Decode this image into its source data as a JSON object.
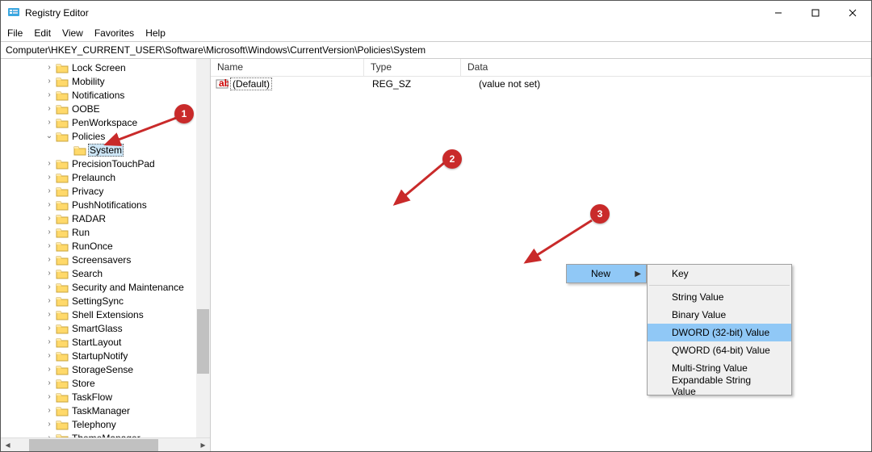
{
  "window": {
    "title": "Registry Editor"
  },
  "menu": {
    "file": "File",
    "edit": "Edit",
    "view": "View",
    "favorites": "Favorites",
    "help": "Help"
  },
  "address": {
    "value": "Computer\\HKEY_CURRENT_USER\\Software\\Microsoft\\Windows\\CurrentVersion\\Policies\\System"
  },
  "tree": {
    "nodes": [
      {
        "label": "Lock Screen",
        "expandable": true,
        "depth": 0
      },
      {
        "label": "Mobility",
        "expandable": true,
        "depth": 0
      },
      {
        "label": "Notifications",
        "expandable": true,
        "depth": 0
      },
      {
        "label": "OOBE",
        "expandable": true,
        "depth": 0
      },
      {
        "label": "PenWorkspace",
        "expandable": true,
        "depth": 0
      },
      {
        "label": "Policies",
        "expandable": true,
        "expanded": true,
        "depth": 0
      },
      {
        "label": "System",
        "expandable": false,
        "depth": 1,
        "selected": true
      },
      {
        "label": "PrecisionTouchPad",
        "expandable": true,
        "depth": 0
      },
      {
        "label": "Prelaunch",
        "expandable": true,
        "depth": 0
      },
      {
        "label": "Privacy",
        "expandable": true,
        "depth": 0
      },
      {
        "label": "PushNotifications",
        "expandable": true,
        "depth": 0
      },
      {
        "label": "RADAR",
        "expandable": true,
        "depth": 0
      },
      {
        "label": "Run",
        "expandable": true,
        "depth": 0
      },
      {
        "label": "RunOnce",
        "expandable": true,
        "depth": 0
      },
      {
        "label": "Screensavers",
        "expandable": true,
        "depth": 0
      },
      {
        "label": "Search",
        "expandable": true,
        "depth": 0
      },
      {
        "label": "Security and Maintenance",
        "expandable": true,
        "depth": 0
      },
      {
        "label": "SettingSync",
        "expandable": true,
        "depth": 0
      },
      {
        "label": "Shell Extensions",
        "expandable": true,
        "depth": 0
      },
      {
        "label": "SmartGlass",
        "expandable": true,
        "depth": 0
      },
      {
        "label": "StartLayout",
        "expandable": true,
        "depth": 0
      },
      {
        "label": "StartupNotify",
        "expandable": true,
        "depth": 0
      },
      {
        "label": "StorageSense",
        "expandable": true,
        "depth": 0
      },
      {
        "label": "Store",
        "expandable": true,
        "depth": 0
      },
      {
        "label": "TaskFlow",
        "expandable": true,
        "depth": 0
      },
      {
        "label": "TaskManager",
        "expandable": true,
        "depth": 0
      },
      {
        "label": "Telephony",
        "expandable": true,
        "depth": 0
      },
      {
        "label": "ThemeManager",
        "expandable": true,
        "depth": 0
      }
    ]
  },
  "list": {
    "cols": {
      "name": "Name",
      "type": "Type",
      "data": "Data"
    },
    "rows": [
      {
        "name": "(Default)",
        "type": "REG_SZ",
        "data": "(value not set)"
      }
    ]
  },
  "context": {
    "new": "New",
    "sub": {
      "key": "Key",
      "string": "String Value",
      "binary": "Binary Value",
      "dword": "DWORD (32-bit) Value",
      "qword": "QWORD (64-bit) Value",
      "multi": "Multi-String Value",
      "expand": "Expandable String Value"
    }
  },
  "annotations": {
    "b1": "1",
    "b2": "2",
    "b3": "3"
  }
}
